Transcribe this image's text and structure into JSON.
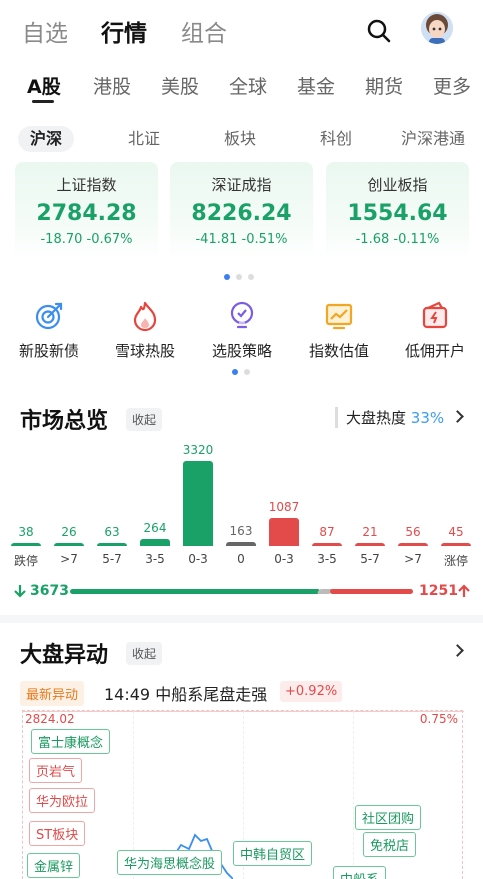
{
  "top_nav": {
    "tabs": [
      "自选",
      "行情",
      "组合"
    ],
    "active": "行情"
  },
  "market_tabs": [
    "A股",
    "港股",
    "美股",
    "全球",
    "基金",
    "期货",
    "更多"
  ],
  "sub_tabs": [
    "沪深",
    "北证",
    "板块",
    "科创",
    "沪深港通"
  ],
  "index_cards": [
    {
      "name": "上证指数",
      "value": "2784.28",
      "change": "-18.70 -0.67%"
    },
    {
      "name": "深证成指",
      "value": "8226.24",
      "change": "-41.81 -0.51%"
    },
    {
      "name": "创业板指",
      "value": "1554.64",
      "change": "-1.68 -0.11%"
    }
  ],
  "quick_links": [
    {
      "label": "新股新债",
      "icon": "target-icon"
    },
    {
      "label": "雪球热股",
      "icon": "flame-icon"
    },
    {
      "label": "选股策略",
      "icon": "bulb-icon"
    },
    {
      "label": "指数估值",
      "icon": "chart-board-icon"
    },
    {
      "label": "低佣开户",
      "icon": "wallet-icon"
    }
  ],
  "market_overview": {
    "title": "市场总览",
    "collapse": "收起",
    "heat_label": "大盘热度",
    "heat_value": "33%",
    "distribution": [
      {
        "label": "跌停",
        "count": 38,
        "color": "#1aa168"
      },
      {
        "label": ">7",
        "count": 26,
        "color": "#1aa168"
      },
      {
        "label": "5-7",
        "count": 63,
        "color": "#1aa168"
      },
      {
        "label": "3-5",
        "count": 264,
        "color": "#1aa168"
      },
      {
        "label": "0-3",
        "count": 3320,
        "color": "#1aa168"
      },
      {
        "label": "0",
        "count": 163,
        "color": "#666666"
      },
      {
        "label": "0-3",
        "count": 1087,
        "color": "#e34a4a"
      },
      {
        "label": "3-5",
        "count": 87,
        "color": "#e34a4a"
      },
      {
        "label": "5-7",
        "count": 21,
        "color": "#e34a4a"
      },
      {
        "label": ">7",
        "count": 56,
        "color": "#e34a4a"
      },
      {
        "label": "涨停",
        "count": 45,
        "color": "#e34a4a"
      }
    ],
    "down_total": "3673",
    "up_total": "1251"
  },
  "movers": {
    "title": "大盘异动",
    "collapse": "收起",
    "latest_tag": "最新异动",
    "latest_time": "14:49",
    "latest_text": "中船系尾盘走强",
    "latest_pct": "+0.92%",
    "chart_high": "2824.02",
    "chart_high_pct": "0.75%",
    "tags": [
      {
        "text": "富士康概念",
        "type": "g"
      },
      {
        "text": "页岩气",
        "type": "r"
      },
      {
        "text": "华为欧拉",
        "type": "r"
      },
      {
        "text": "ST板块",
        "type": "r"
      },
      {
        "text": "金属锌",
        "type": "g"
      },
      {
        "text": "华为海思概念股",
        "type": "g"
      },
      {
        "text": "中韩自贸区",
        "type": "g"
      },
      {
        "text": "社区团购",
        "type": "g"
      },
      {
        "text": "免税店",
        "type": "g"
      },
      {
        "text": "中船系",
        "type": "g"
      }
    ]
  }
}
